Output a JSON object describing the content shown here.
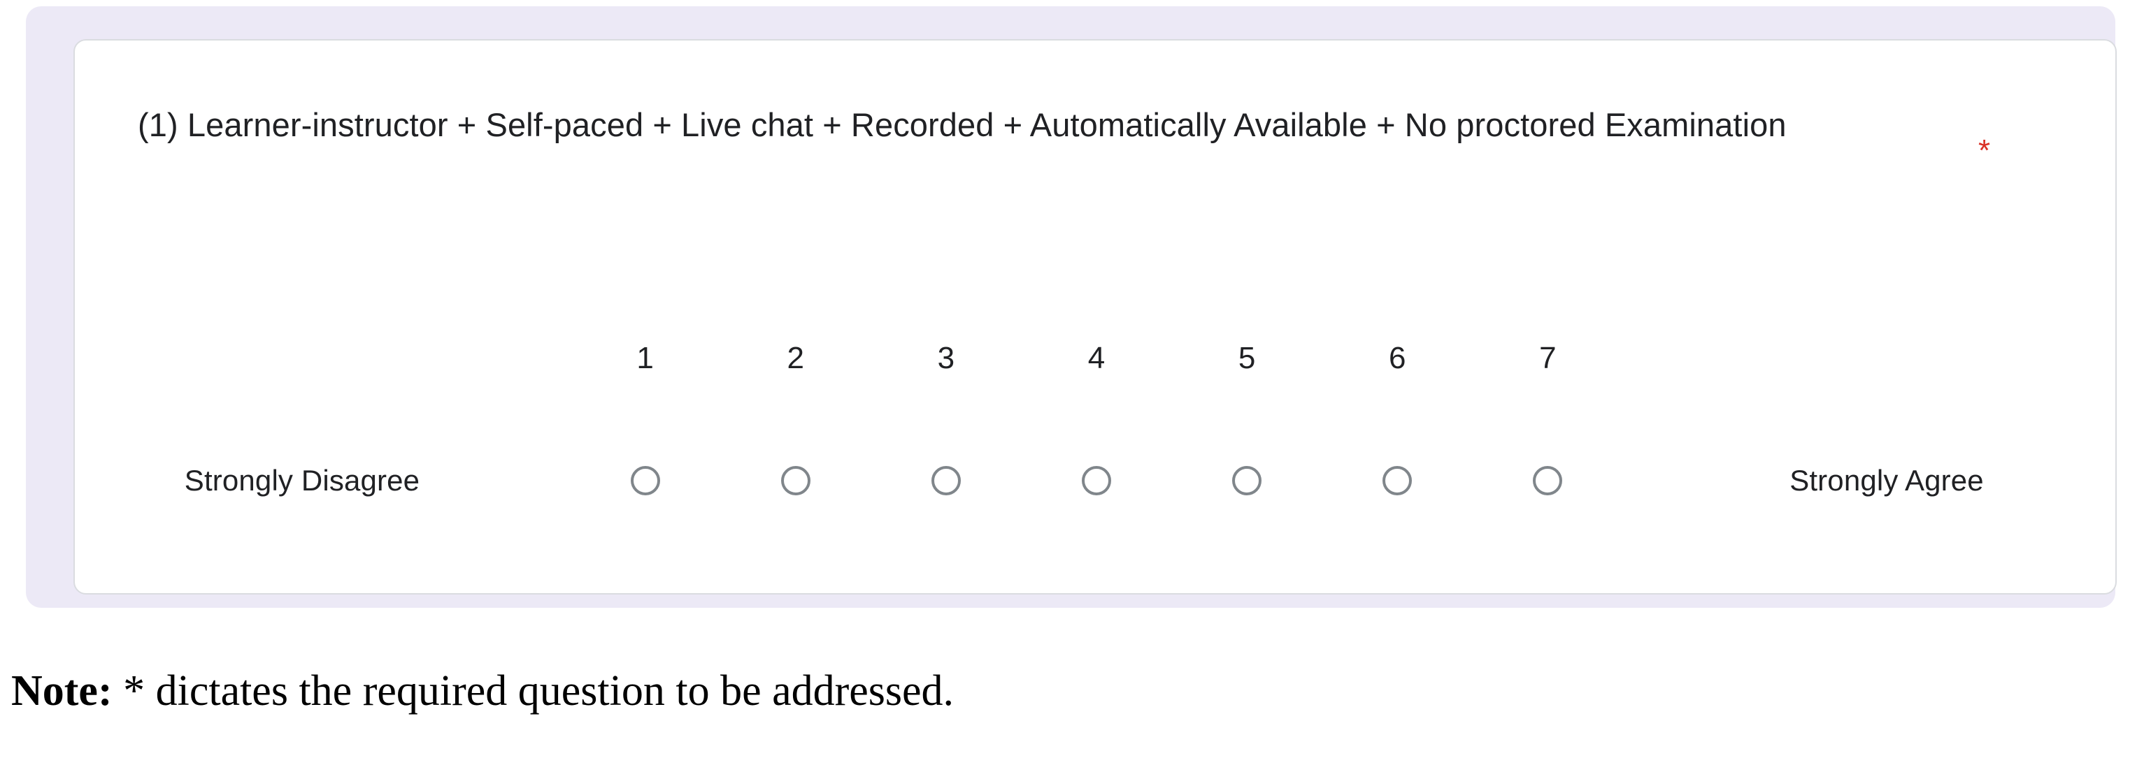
{
  "form": {
    "question": {
      "number_prefix": "(1)",
      "text": "(1) Learner-instructor + Self-paced + Live chat + Recorded + Automatically Available + No proctored Examination",
      "required_marker": "*",
      "required_marker_color": "#d93025"
    },
    "likert": {
      "type": "linear-scale",
      "scale_points": [
        "1",
        "2",
        "3",
        "4",
        "5",
        "6",
        "7"
      ],
      "low_label": "Strongly Disagree",
      "high_label": "Strongly Agree",
      "selected": null,
      "option_icon": "radio-unselected-icon",
      "option_border_color": "#80868b"
    },
    "colors": {
      "card_background": "#ffffff",
      "frame_background": "#ece9f6",
      "card_border": "#dadce0",
      "text": "#202124"
    }
  },
  "note": {
    "label": "Note:",
    "body": " * dictates the required question to be addressed."
  }
}
